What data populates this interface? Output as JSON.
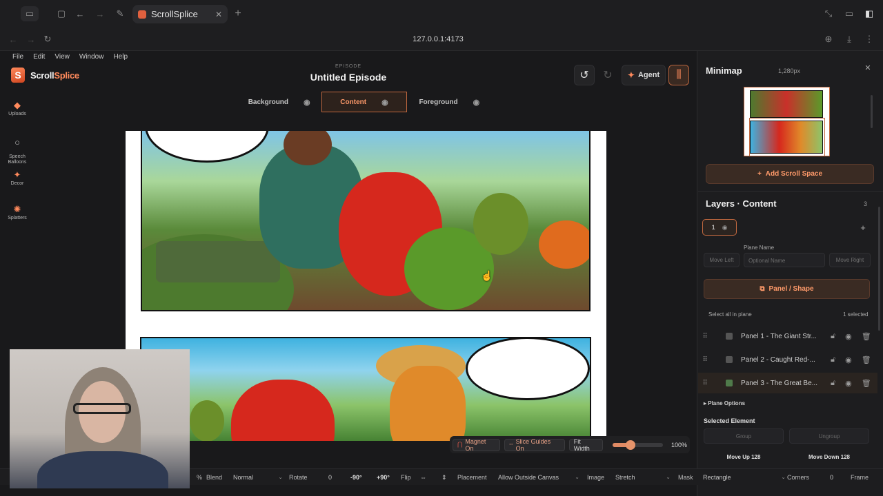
{
  "browser": {
    "tab_title": "ScrollSplice",
    "url": "127.0.0.1:4173"
  },
  "menu": [
    "File",
    "Edit",
    "View",
    "Window",
    "Help"
  ],
  "brand": {
    "name_a": "Scroll",
    "name_b": "Splice"
  },
  "tools": [
    {
      "label": "Uploads",
      "icon": "upload-icon"
    },
    {
      "label": "Speech\nBalloons",
      "icon": "balloon-icon"
    },
    {
      "label": "Decor",
      "icon": "star-icon"
    },
    {
      "label": "Splatters",
      "icon": "splatter-icon"
    }
  ],
  "episode": {
    "label": "EPISODE",
    "title": "Untitled Episode"
  },
  "header": {
    "agent_label": "Agent"
  },
  "layer_tabs": [
    {
      "label": "Background",
      "active": false
    },
    {
      "label": "Content",
      "active": true
    },
    {
      "label": "Foreground",
      "active": false
    }
  ],
  "float_bar": {
    "magnet": "Magnet On",
    "slice_guides": "Slice Guides On",
    "fit_width": "Fit Width",
    "zoom": "100%",
    "zoom_fraction": 0.35
  },
  "bottom_bar": {
    "percent": "%",
    "blend_label": "Blend",
    "blend_value": "Normal",
    "rotate_label": "Rotate",
    "rotate_value": "0",
    "rot_minus": "-90°",
    "rot_plus": "+90°",
    "flip_label": "Flip",
    "placement_label": "Placement",
    "placement_value": "Allow Outside Canvas",
    "image_label": "Image",
    "image_value": "Stretch",
    "mask_label": "Mask",
    "mask_value": "Rectangle",
    "corners_label": "Corners",
    "corners_value": "0",
    "frame_label": "Frame"
  },
  "minimap": {
    "title": "Minimap",
    "width": "1,280px",
    "add_scroll": "Add Scroll Space"
  },
  "layers": {
    "title": "Layers · Content",
    "count": "3",
    "plane_number": "1",
    "plane_name_label": "Plane Name",
    "move_left": "Move Left",
    "plane_name_placeholder": "Optional Name",
    "move_right": "Move Right",
    "panel_shape": "Panel / Shape",
    "select_all": "Select all in plane",
    "selected_count": "1 selected",
    "items": [
      {
        "name": "Panel 1 - The Giant Str..."
      },
      {
        "name": "Panel 2 - Caught Red-..."
      },
      {
        "name": "Panel 3 - The Great Be..."
      }
    ],
    "plane_options": "▸ Plane Options",
    "selected_element": "Selected Element",
    "group": "Group",
    "ungroup": "Ungroup",
    "move_up": "Move Up 128",
    "move_down": "Move Down 128"
  },
  "colors": {
    "accent": "#ff8a5c",
    "panel_bg": "#1d1d1f"
  }
}
